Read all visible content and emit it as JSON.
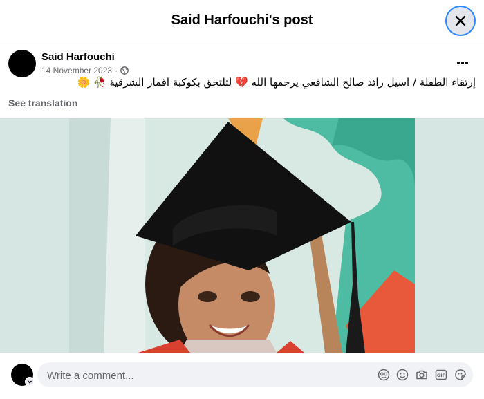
{
  "header": {
    "title": "Said Harfouchi's post"
  },
  "post": {
    "author": "Said Harfouchi",
    "date": "14 November 2023",
    "privacy_icon": "globe-icon",
    "text": "إرتقاء الطفلة / اسيل رائد صالح الشافعي يرحمها الله 💔 لتلتحق بكوكبة اقمار الشرقية 🥀 🌼",
    "see_translation": "See translation"
  },
  "composer": {
    "placeholder": "Write a comment..."
  },
  "colors": {
    "accent": "#2d88ff",
    "surface": "#f0f2f5",
    "secondary_text": "#65676b"
  }
}
